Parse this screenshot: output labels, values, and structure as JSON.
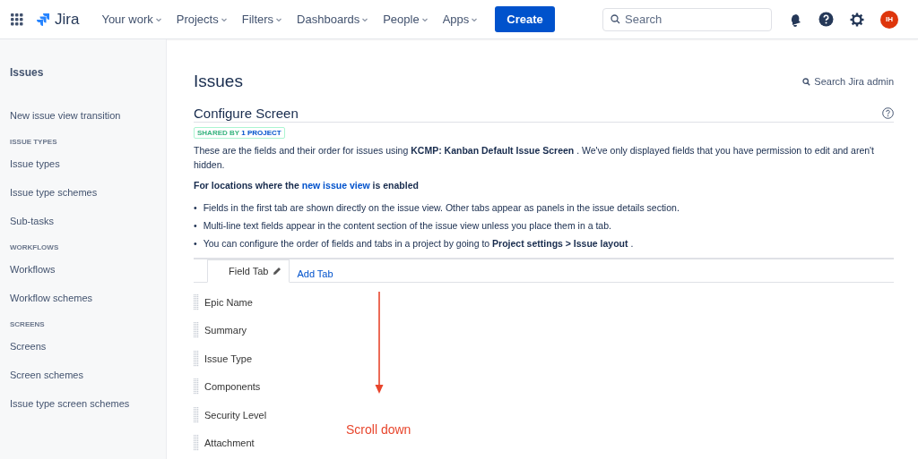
{
  "nav": {
    "logo": "Jira",
    "menus": [
      "Your work",
      "Projects",
      "Filters",
      "Dashboards",
      "People",
      "Apps"
    ],
    "create": "Create",
    "search": {
      "placeholder": "Search"
    },
    "avatar": "IH"
  },
  "sidebar": {
    "title": "Issues",
    "items": [
      {
        "kind": "link",
        "label": "New issue view transition"
      },
      {
        "kind": "heading",
        "label": "ISSUE TYPES"
      },
      {
        "kind": "link",
        "label": "Issue types"
      },
      {
        "kind": "link",
        "label": "Issue type schemes"
      },
      {
        "kind": "link",
        "label": "Sub-tasks"
      },
      {
        "kind": "heading",
        "label": "WORKFLOWS"
      },
      {
        "kind": "link",
        "label": "Workflows"
      },
      {
        "kind": "link",
        "label": "Workflow schemes"
      },
      {
        "kind": "heading",
        "label": "SCREENS"
      },
      {
        "kind": "link",
        "label": "Screens"
      },
      {
        "kind": "link",
        "label": "Screen schemes"
      },
      {
        "kind": "link",
        "label": "Issue type screen schemes"
      }
    ]
  },
  "page": {
    "title": "Issues",
    "admin_search": "Search Jira admin",
    "heading": "Configure Screen",
    "badge": {
      "prefix": "SHARED BY",
      "link": "1 PROJECT"
    },
    "description": "These are the fields and their order for issues using **KCMP: Kanban Default Issue Screen** . We've only displayed fields that you have permission to edit and aren't hidden.",
    "note": {
      "before": "For locations where the",
      "link": "new issue view",
      "after": "is enabled"
    },
    "bullets": [
      {
        "marker": "•",
        "text": "Fields in the first tab are shown directly on the issue view. Other tabs appear as panels in the issue details section."
      },
      {
        "marker": "•",
        "text": "Multi-line text fields appear in the content section of the issue view unless you place them in a tab."
      },
      {
        "marker": "•",
        "text": "You can configure the order of fields and tabs in a project by going to **Project settings > Issue layout** ."
      }
    ],
    "tabs": [
      {
        "label": "Field Tab",
        "selected": true
      }
    ],
    "add_tab": "Add Tab",
    "fields": [
      "Epic Name",
      "Summary",
      "Issue Type",
      "Components",
      "Security Level",
      "Attachment"
    ],
    "annotation": "Scroll down"
  }
}
